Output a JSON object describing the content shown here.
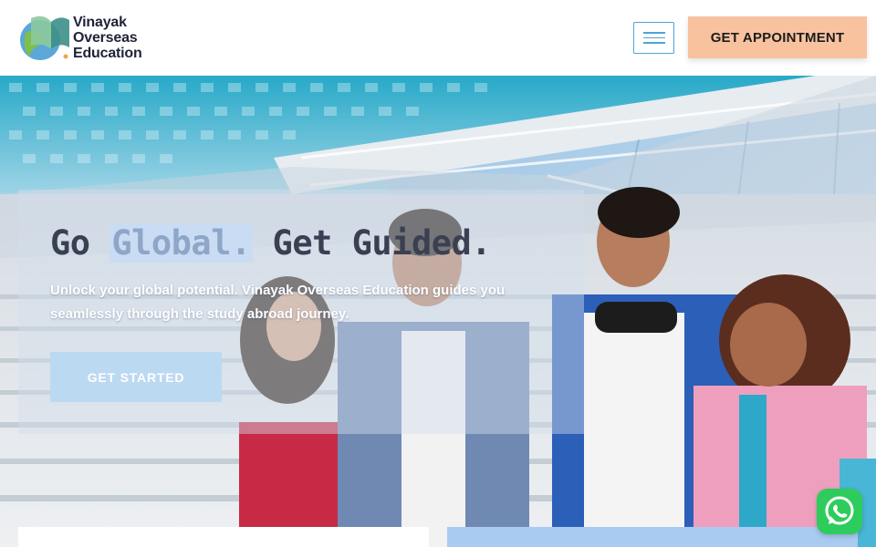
{
  "header": {
    "logo_lines": [
      "Vinayak",
      "Overseas",
      "Education"
    ],
    "appointment_label": "GET APPOINTMENT",
    "menu_icon": "hamburger-icon"
  },
  "hero": {
    "headline_before": "Go ",
    "headline_highlight": "Global.",
    "headline_after": " Get Guided.",
    "subtext": "Unlock your global potential. Vinayak Overseas Education guides you seamlessly through the study abroad journey.",
    "cta_label": "GET STARTED"
  },
  "floating": {
    "whatsapp_icon": "whatsapp-icon"
  },
  "colors": {
    "appointment_bg": "#f9c29f",
    "menu_border": "#4fa3d8",
    "cta_bg": "#bcd9f2",
    "whatsapp": "#2ecc5c",
    "headline": "#3b3f52"
  }
}
